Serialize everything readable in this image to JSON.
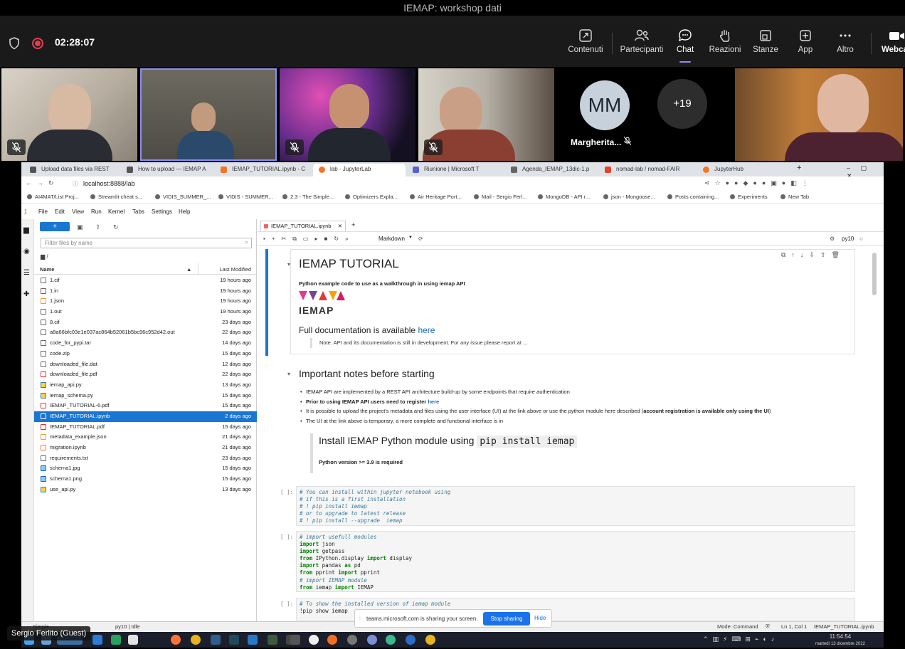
{
  "teams": {
    "window_title": "IEMAP: workshop dati",
    "timer": "02:28:07",
    "buttons": [
      {
        "label": "Contenuti",
        "icon": "share-icon"
      },
      {
        "label": "Partecipanti",
        "icon": "people-icon"
      },
      {
        "label": "Chat",
        "icon": "chat-icon"
      },
      {
        "label": "Reazioni",
        "icon": "hand-icon"
      },
      {
        "label": "Stanze",
        "icon": "rooms-icon"
      },
      {
        "label": "App",
        "icon": "plus-icon"
      },
      {
        "label": "Altro",
        "icon": "more-icon"
      },
      {
        "label": "Webca",
        "icon": "camera-icon"
      }
    ],
    "participant_initials": "MM",
    "participant_name": "Margherita...",
    "extra_participants": "+19",
    "guest_label": "Sergio Ferlito (Guest)"
  },
  "browser": {
    "tabs": [
      "Upload data files via REST",
      "How to upload — IEMAP A",
      "IEMAP_TUTORIAL.ipynb - C",
      "lab - JupyterLab",
      "Riunione | Microsoft T",
      "Agenda_IEMAP_13dic-1.p",
      "nomad-lab / nomad-FAIR",
      "JupyterHub"
    ],
    "url": "localhost:8888/lab",
    "bookmarks": [
      "AI4MAT/List Proj...",
      "Streamlit cheat s...",
      "VIDIS_SUMMER_...",
      "VIDIS - SUMMER...",
      "2.3 - The Simple...",
      "Optimizers Expla...",
      "Air Heritage Port...",
      "Mail - Sergio Ferl...",
      "MongoDB - API r...",
      "json - Mongoose...",
      "Posts containing...",
      "Experiments",
      "New Tab"
    ]
  },
  "jupyter": {
    "menu": [
      "File",
      "Edit",
      "View",
      "Run",
      "Kernel",
      "Tabs",
      "Settings",
      "Help"
    ],
    "filter_placeholder": "Filter files by name",
    "breadcrumb": "/",
    "col_name": "Name",
    "col_modified": "Last Modified",
    "files": [
      {
        "name": "1.cif",
        "modified": "19 hours ago"
      },
      {
        "name": "1.in",
        "modified": "19 hours ago"
      },
      {
        "name": "1.json",
        "modified": "19 hours ago"
      },
      {
        "name": "1.out",
        "modified": "19 hours ago"
      },
      {
        "name": "8.cif",
        "modified": "23 days ago"
      },
      {
        "name": "a8a66bfc03e1e037ac864b52061b5bc96c952d42.out",
        "modified": "22 days ago"
      },
      {
        "name": "code_for_pypi.tar",
        "modified": "14 days ago"
      },
      {
        "name": "code.zip",
        "modified": "15 days ago"
      },
      {
        "name": "downloaded_file.dat",
        "modified": "12 days ago"
      },
      {
        "name": "downloaded_file.pdf",
        "modified": "22 days ago"
      },
      {
        "name": "iemap_api.py",
        "modified": "13 days ago"
      },
      {
        "name": "iemap_schema.py",
        "modified": "15 days ago"
      },
      {
        "name": "IEMAP_TUTORIAL-6.pdf",
        "modified": "15 days ago"
      },
      {
        "name": "IEMAP_TUTORIAL.ipynb",
        "modified": "2 days ago"
      },
      {
        "name": "IEMAP_TUTORIAL.pdf",
        "modified": "15 days ago"
      },
      {
        "name": "metadata_example.json",
        "modified": "21 days ago"
      },
      {
        "name": "migration.ipynb",
        "modified": "21 days ago"
      },
      {
        "name": "requirements.txt",
        "modified": "23 days ago"
      },
      {
        "name": "schema1.jpg",
        "modified": "15 days ago"
      },
      {
        "name": "schema1.png",
        "modified": "15 days ago"
      },
      {
        "name": "use_api.py",
        "modified": "13 days ago"
      }
    ],
    "notebook_tab": "IEMAP_TUTORIAL.ipynb",
    "cell_type": "Markdown",
    "kernel": "py10",
    "nb": {
      "title": "IEMAP TUTORIAL",
      "subtitle": "Python example code to use as a walkthrough in using iemap API",
      "logo_text": "IEMAP",
      "fulldoc": "Full documentation is available",
      "here": "here",
      "note": "Note. API and its documentation is still in development. For any issue please report at ...",
      "notes_title": "Important notes before starting",
      "bullet1": "IEMAP API are implemented by a REST API architecture build-up by some endpoints that require authentication",
      "bullet2": "Prior to using IEMAP API users need to register",
      "bullet3a": "It is possible to upload the project's metadata and files using the user interface (UI) at the link above or use the python module here described (",
      "bullet3b": "account registration is available only using the UI",
      "bullet3c": ")",
      "bullet4": "The UI at the link above is temporary, a more complete and functional interface is in",
      "install_title": "Install IEMAP Python module using",
      "install_cmd": "pip install iemap",
      "pyver": "Python version >= 3.9 is required",
      "prompt": "[ ]:"
    },
    "status_left": "Simple",
    "status_kernel": "py10 | Idle",
    "status_mode": "Mode: Command",
    "status_pos": "Ln 1, Col 1",
    "status_file": "IEMAP_TUTORIAL.ipynb"
  },
  "sharing": {
    "text": "teams.microsoft.com is sharing your screen.",
    "stop": "Stop sharing",
    "hide": "Hide"
  },
  "taskbar": {
    "time": "11:54:54",
    "date": "martedì 13 dicembre 2022"
  }
}
